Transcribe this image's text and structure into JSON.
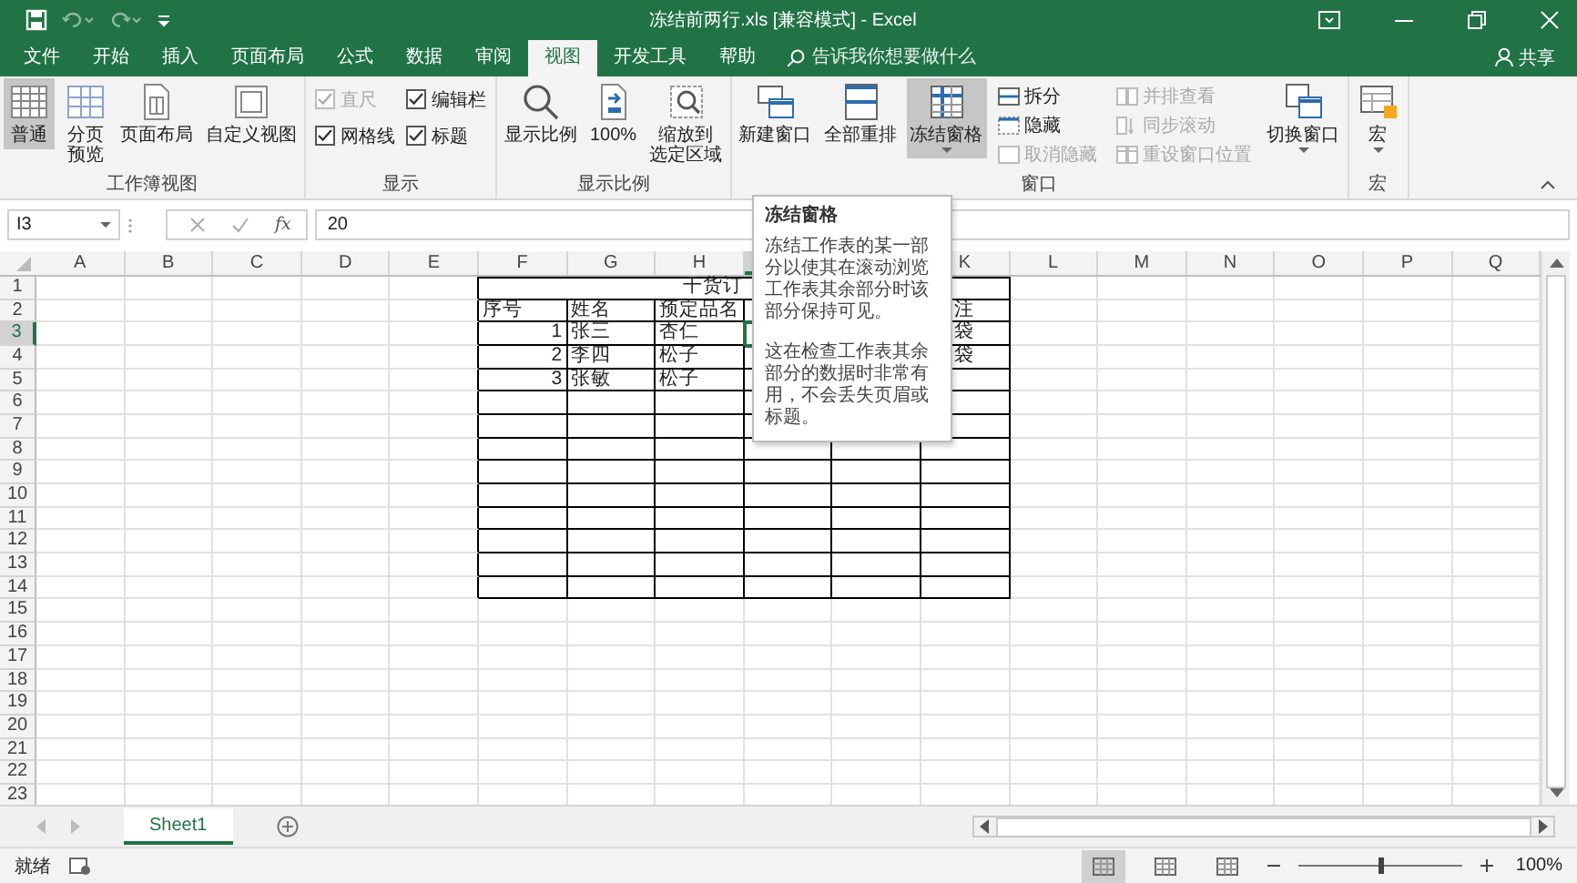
{
  "window": {
    "title": "冻结前两行.xls  [兼容模式]  -  Excel"
  },
  "menu_tabs": [
    {
      "label": "文件",
      "selected": false
    },
    {
      "label": "开始",
      "selected": false
    },
    {
      "label": "插入",
      "selected": false
    },
    {
      "label": "页面布局",
      "selected": false
    },
    {
      "label": "公式",
      "selected": false
    },
    {
      "label": "数据",
      "selected": false
    },
    {
      "label": "审阅",
      "selected": false
    },
    {
      "label": "视图",
      "selected": true
    },
    {
      "label": "开发工具",
      "selected": false
    },
    {
      "label": "帮助",
      "selected": false
    }
  ],
  "tell_me": {
    "placeholder": "告诉我你想要做什么"
  },
  "share": "共享",
  "ribbon": {
    "groups": [
      {
        "label": "工作簿视图",
        "items": [
          {
            "kind": "large",
            "lines": [
              "普通"
            ],
            "selected": true,
            "dropdown": false
          },
          {
            "kind": "large",
            "lines": [
              "分页",
              "预览"
            ],
            "selected": false,
            "dropdown": false
          },
          {
            "kind": "large",
            "lines": [
              "页面布局"
            ],
            "selected": false,
            "dropdown": false
          },
          {
            "kind": "large",
            "lines": [
              "自定义视图"
            ],
            "selected": false,
            "dropdown": false
          }
        ]
      },
      {
        "label": "显示",
        "items": [
          {
            "kind": "check",
            "label": "直尺",
            "checked": true,
            "disabled": true
          },
          {
            "kind": "check",
            "label": "网格线",
            "checked": true,
            "disabled": false
          },
          {
            "kind": "check",
            "label": "编辑栏",
            "checked": true,
            "disabled": false
          },
          {
            "kind": "check",
            "label": "标题",
            "checked": true,
            "disabled": false
          }
        ]
      },
      {
        "label": "显示比例",
        "items": [
          {
            "kind": "large",
            "lines": [
              "显示比例"
            ],
            "selected": false,
            "dropdown": false
          },
          {
            "kind": "large",
            "lines": [
              "100%"
            ],
            "selected": false,
            "dropdown": false
          },
          {
            "kind": "large",
            "lines": [
              "缩放到",
              "选定区域"
            ],
            "selected": false,
            "dropdown": false
          }
        ]
      },
      {
        "label": "窗口",
        "items": [
          {
            "kind": "large",
            "lines": [
              "新建窗口"
            ],
            "selected": false,
            "dropdown": false
          },
          {
            "kind": "large",
            "lines": [
              "全部重排"
            ],
            "selected": false,
            "dropdown": false
          },
          {
            "kind": "large",
            "lines": [
              "冻结窗格"
            ],
            "selected": true,
            "dropdown": true
          },
          {
            "kind": "small",
            "label": "拆分",
            "disabled": false
          },
          {
            "kind": "small",
            "label": "隐藏",
            "disabled": false
          },
          {
            "kind": "small",
            "label": "取消隐藏",
            "disabled": true
          },
          {
            "kind": "small",
            "label": "并排查看",
            "disabled": true
          },
          {
            "kind": "small",
            "label": "同步滚动",
            "disabled": true
          },
          {
            "kind": "small",
            "label": "重设窗口位置",
            "disabled": true
          },
          {
            "kind": "large",
            "lines": [
              "切换窗口"
            ],
            "selected": false,
            "dropdown": true
          }
        ]
      },
      {
        "label": "宏",
        "items": [
          {
            "kind": "large",
            "lines": [
              "宏"
            ],
            "selected": false,
            "dropdown": true
          }
        ]
      }
    ]
  },
  "formula_bar": {
    "name_box": "I3",
    "function_label": "fx",
    "value": "20"
  },
  "tooltip": {
    "title": "冻结窗格",
    "paragraphs": [
      "冻结工作表的某一部分以使其在滚动浏览工作表其余部分时该部分保持可见。",
      "这在检查工作表其余部分的数据时非常有用，不会丢失页眉或标题。"
    ]
  },
  "sheet": {
    "columns": [
      {
        "letter": "A",
        "selected": false
      },
      {
        "letter": "B",
        "selected": false
      },
      {
        "letter": "C",
        "selected": false
      },
      {
        "letter": "D",
        "selected": false
      },
      {
        "letter": "E",
        "selected": false
      },
      {
        "letter": "F",
        "selected": false
      },
      {
        "letter": "G",
        "selected": false
      },
      {
        "letter": "H",
        "selected": false
      },
      {
        "selected": true
      },
      {},
      {
        "letter": "K",
        "selected": false
      },
      {
        "letter": "L",
        "selected": false
      },
      {
        "letter": "M",
        "selected": false
      },
      {
        "letter": "N",
        "selected": false
      },
      {
        "letter": "O",
        "selected": false
      },
      {
        "letter": "P",
        "selected": false
      },
      {
        "letter": "Q",
        "selected": false
      }
    ],
    "rows": [
      {
        "number": "1",
        "selected": false,
        "cells": {
          "F": {
            "text": "干货订",
            "kind": "title"
          }
        }
      },
      {
        "number": "2",
        "selected": false,
        "cells": {
          "F": {
            "text": "序号",
            "kind": "text"
          },
          "G": {
            "text": "姓名",
            "kind": "text"
          },
          "H": {
            "text": "预定品名",
            "kind": "text"
          },
          "K": {
            "text": "注",
            "kind": "partial"
          }
        }
      },
      {
        "number": "3",
        "selected": true,
        "cells": {
          "F": {
            "text": "1",
            "kind": "number"
          },
          "G": {
            "text": "张三",
            "kind": "text"
          },
          "H": {
            "text": "杏仁",
            "kind": "text"
          },
          "K": {
            "text": "袋",
            "kind": "partial"
          }
        }
      },
      {
        "number": "4",
        "selected": false,
        "cells": {
          "F": {
            "text": "2",
            "kind": "number"
          },
          "G": {
            "text": "李四",
            "kind": "text"
          },
          "H": {
            "text": "松子",
            "kind": "text"
          },
          "K": {
            "text": "袋",
            "kind": "partial"
          }
        }
      },
      {
        "number": "5",
        "selected": false,
        "cells": {
          "F": {
            "text": "3",
            "kind": "number"
          },
          "G": {
            "text": "张敏",
            "kind": "text"
          },
          "H": {
            "text": "松子",
            "kind": "text"
          }
        }
      },
      {
        "number": "6",
        "selected": false
      },
      {
        "number": "7",
        "selected": false
      },
      {
        "number": "8",
        "selected": false
      },
      {
        "number": "9",
        "selected": false
      },
      {
        "number": "10",
        "selected": false
      },
      {
        "number": "11",
        "selected": false
      },
      {
        "number": "12",
        "selected": false
      },
      {
        "number": "13",
        "selected": false
      },
      {
        "number": "14",
        "selected": false
      },
      {
        "number": "15",
        "selected": false
      },
      {
        "number": "16",
        "selected": false
      },
      {
        "number": "17",
        "selected": false
      },
      {
        "number": "18",
        "selected": false
      },
      {
        "number": "19",
        "selected": false
      },
      {
        "number": "20",
        "selected": false
      },
      {
        "number": "21",
        "selected": false
      },
      {
        "number": "22",
        "selected": false
      },
      {
        "number": "23",
        "selected": false
      }
    ]
  },
  "sheet_tabs": [
    {
      "label": "Sheet1",
      "selected": true
    }
  ],
  "status_bar": {
    "status": "就绪",
    "views": [
      {
        "selected": true
      },
      {
        "selected": false
      },
      {
        "selected": false
      }
    ],
    "zoom_slider": {
      "level": 0.5
    },
    "zoom": "100%"
  }
}
